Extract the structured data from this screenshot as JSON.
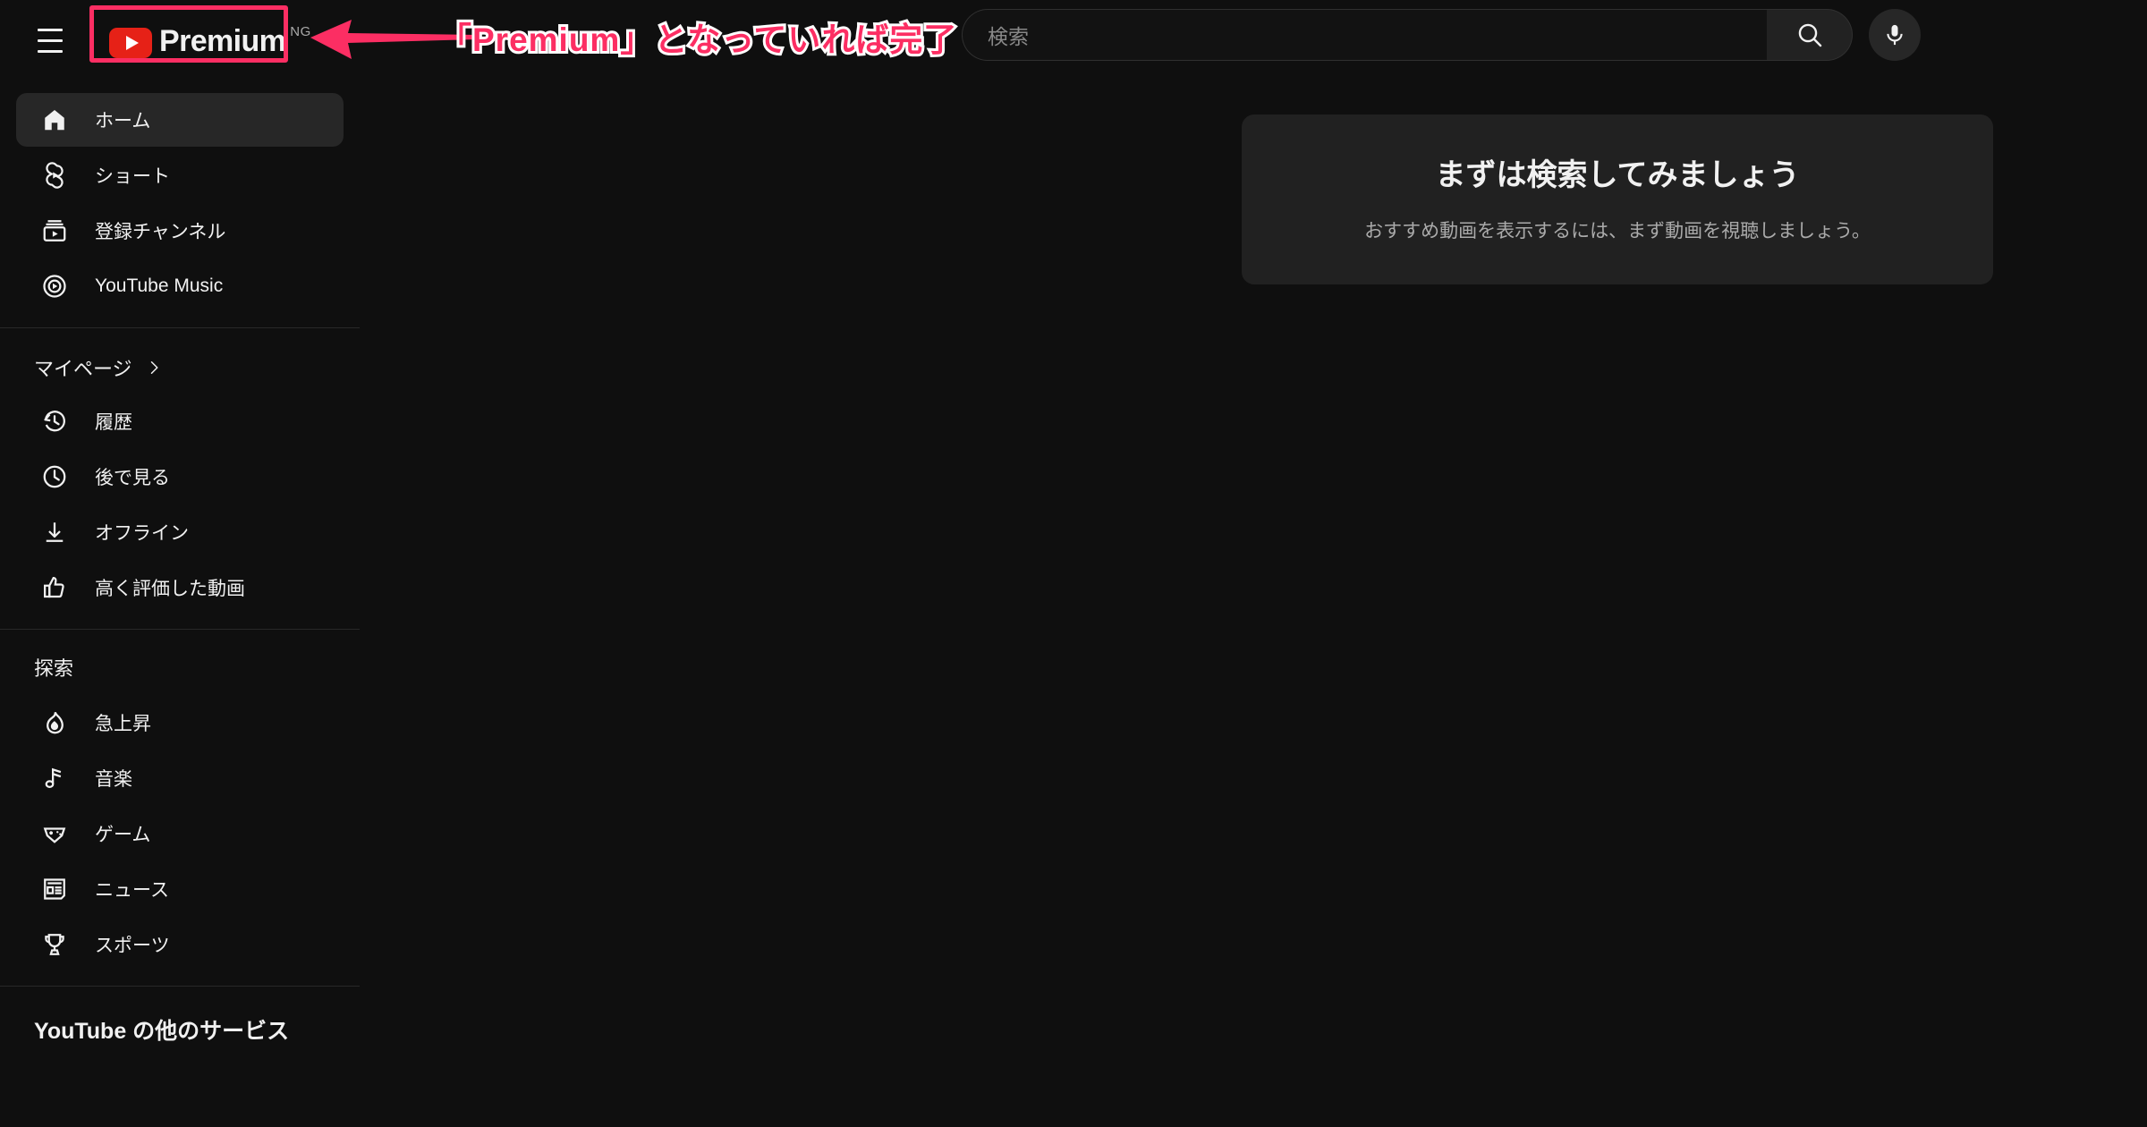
{
  "header": {
    "menu_icon": "hamburger-icon",
    "logo_text": "Premium",
    "logo_country_code": "NG",
    "logo_play_icon": "youtube-play-icon"
  },
  "annotation": {
    "text": "「Premium」となっていれば完了",
    "arrow_icon": "left-arrow-annotation",
    "highlight_color": "#fc2e63",
    "outline_color": "#ffffff"
  },
  "search": {
    "placeholder": "検索",
    "value": "",
    "search_icon": "search-icon",
    "mic_icon": "microphone-icon"
  },
  "sidebar": {
    "primary": [
      {
        "label": "ホーム",
        "icon": "home-icon",
        "active": true
      },
      {
        "label": "ショート",
        "icon": "shorts-icon",
        "active": false
      },
      {
        "label": "登録チャンネル",
        "icon": "subscriptions-icon",
        "active": false
      },
      {
        "label": "YouTube Music",
        "icon": "youtube-music-icon",
        "active": false
      }
    ],
    "you_section": {
      "label": "マイページ",
      "chevron_icon": "chevron-right-icon",
      "items": [
        {
          "label": "履歴",
          "icon": "history-icon"
        },
        {
          "label": "後で見る",
          "icon": "watch-later-icon"
        },
        {
          "label": "オフライン",
          "icon": "download-icon"
        },
        {
          "label": "高く評価した動画",
          "icon": "thumbs-up-icon"
        }
      ]
    },
    "explore_section": {
      "label": "探索",
      "items": [
        {
          "label": "急上昇",
          "icon": "trending-flame-icon"
        },
        {
          "label": "音楽",
          "icon": "music-note-icon"
        },
        {
          "label": "ゲーム",
          "icon": "gamepad-icon"
        },
        {
          "label": "ニュース",
          "icon": "newspaper-icon"
        },
        {
          "label": "スポーツ",
          "icon": "trophy-icon"
        }
      ]
    },
    "more_section": {
      "label": "YouTube の他のサービス"
    }
  },
  "main": {
    "empty_card": {
      "title": "まずは検索してみましょう",
      "subtitle": "おすすめ動画を表示するには、まず動画を視聴しましょう。"
    }
  }
}
